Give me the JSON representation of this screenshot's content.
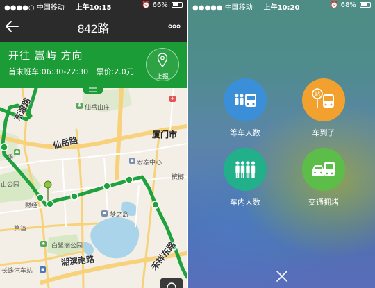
{
  "left": {
    "status": {
      "carrier": "●●●●○ 中国移动",
      "time": "上午10:15",
      "battery": "66%",
      "battery_level": 0.66
    },
    "nav": {
      "title": "842路"
    },
    "banner": {
      "direction": "开往 嵩屿 方向",
      "schedule": "首末班车:06:30-22:30",
      "fare": "票价:2.0元",
      "report_label": "上报"
    },
    "map": {
      "districts": [
        "仙岳山庄",
        "厦门市",
        "宏泰中心",
        "梦之岛",
        "白鹭洲公园",
        "长途汽车站",
        "筼筜",
        "财经"
      ],
      "roads": [
        "仙岳路",
        "湖滨南路",
        "禾祥东路",
        "东渡路"
      ],
      "partial_labels": [
        "场",
        "山公园",
        "槟榔"
      ]
    }
  },
  "right": {
    "status": {
      "carrier": "●●●●● 中国移动",
      "time": "上午10:20",
      "battery": "68%",
      "battery_level": 0.68
    },
    "actions": [
      {
        "label": "等车人数",
        "color": "#3b8fd9"
      },
      {
        "label": "车到了",
        "color": "#f2a12e",
        "badge": "站"
      },
      {
        "label": "车内人数",
        "color": "#22b08a"
      },
      {
        "label": "交通拥堵",
        "color": "#5cbe48"
      }
    ]
  }
}
